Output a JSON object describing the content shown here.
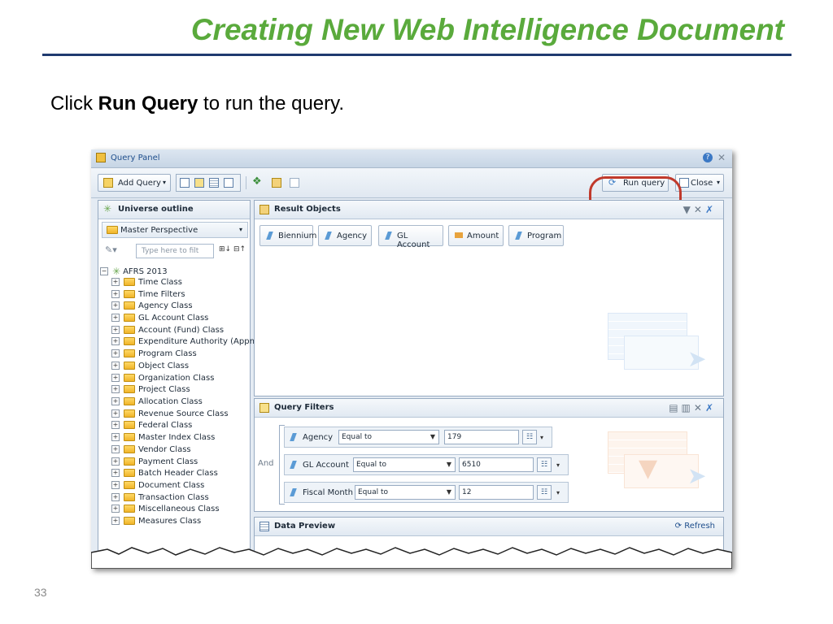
{
  "slide": {
    "title": "Creating New Web Intelligence Document",
    "instruction_prefix": "Click ",
    "instruction_bold": "Run Query",
    "instruction_suffix": " to run the query.",
    "page_number": "33"
  },
  "window": {
    "title": "Query Panel"
  },
  "toolbar": {
    "add_query_label": "Add Query",
    "run_query_label": "Run query",
    "close_label": "Close"
  },
  "universe_outline": {
    "header": "Universe outline",
    "perspective": "Master Perspective",
    "filter_placeholder": "Type here to filt",
    "root": "AFRS 2013",
    "items": [
      "Time Class",
      "Time Filters",
      "Agency Class",
      "GL Account Class",
      "Account (Fund) Class",
      "Expenditure Authority (Appn)",
      "Program Class",
      "Object Class",
      "Organization Class",
      "Project Class",
      "Allocation Class",
      "Revenue Source Class",
      "Federal Class",
      "Master Index Class",
      "Vendor Class",
      "Payment Class",
      "Batch Header Class",
      "Document Class",
      "Transaction Class",
      "Miscellaneous Class",
      "Measures Class"
    ]
  },
  "result_objects": {
    "header": "Result Objects",
    "objects": [
      "Biennium",
      "Agency",
      "GL Account",
      "Amount",
      "Program"
    ]
  },
  "query_filters": {
    "header": "Query Filters",
    "operator": "And",
    "conditions": [
      {
        "object": "Agency",
        "operator": "Equal to",
        "value": "179"
      },
      {
        "object": "GL Account",
        "operator": "Equal to",
        "value": "6510"
      },
      {
        "object": "Fiscal Month",
        "operator": "Equal to",
        "value": "12"
      }
    ]
  },
  "data_preview": {
    "header": "Data Preview",
    "refresh_label": "Refresh"
  },
  "colors": {
    "title_green": "#5aaa3c",
    "rule_navy": "#1f3a6f",
    "highlight_red": "#c0392b"
  }
}
